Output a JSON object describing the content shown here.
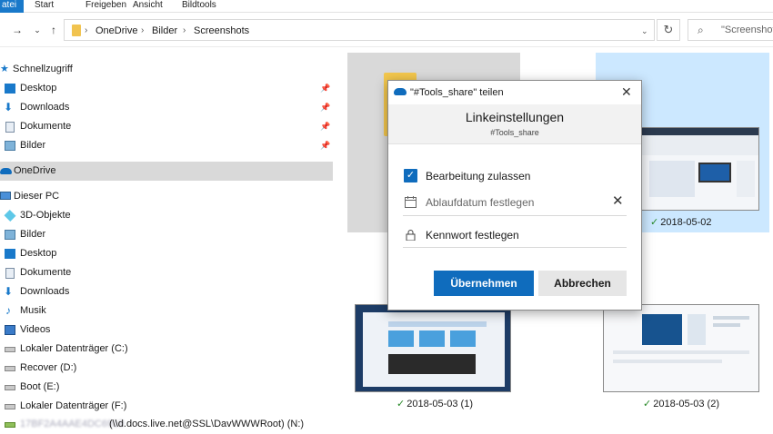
{
  "ribbon": {
    "file_tab": "atei",
    "tabs": [
      "Start",
      "Freigeben",
      "Ansicht",
      "Bildtools"
    ]
  },
  "address": {
    "breadcrumbs": [
      "OneDrive",
      "Bilder",
      "Screenshots"
    ],
    "search_placeholder": "\"Screenshots"
  },
  "nav": {
    "quick_access": "Schnellzugriff",
    "quick_items": [
      "Desktop",
      "Downloads",
      "Dokumente",
      "Bilder"
    ],
    "onedrive": "OneDrive",
    "this_pc": "Dieser PC",
    "pc_items": [
      "3D-Objekte",
      "Bilder",
      "Desktop",
      "Dokumente",
      "Downloads",
      "Musik",
      "Videos",
      "Lokaler Datenträger (C:)",
      "Recover (D:)",
      "Boot (E:)",
      "Lokaler Datenträger (F:)"
    ],
    "network_drive_blurred": "17BF2A4AAE4DC6919",
    "network_drive_label": "(\\\\d.docs.live.net@SSL\\DavWWWRoot) (N:)"
  },
  "content": {
    "captions": [
      "2018-05-02",
      "2018-05-03 (1)",
      "2018-05-03 (2)"
    ]
  },
  "dialog": {
    "title": "\"#Tools_share\" teilen",
    "heading": "Linkeinstellungen",
    "subheading": "#Tools_share",
    "allow_editing": "Bearbeitung zulassen",
    "expiry": "Ablaufdatum festlegen",
    "password": "Kennwort festlegen",
    "apply": "Übernehmen",
    "cancel": "Abbrechen"
  },
  "colors": {
    "accent": "#0f6cbd",
    "selection": "#cce8ff",
    "sync_ok": "#2a8a2a"
  }
}
